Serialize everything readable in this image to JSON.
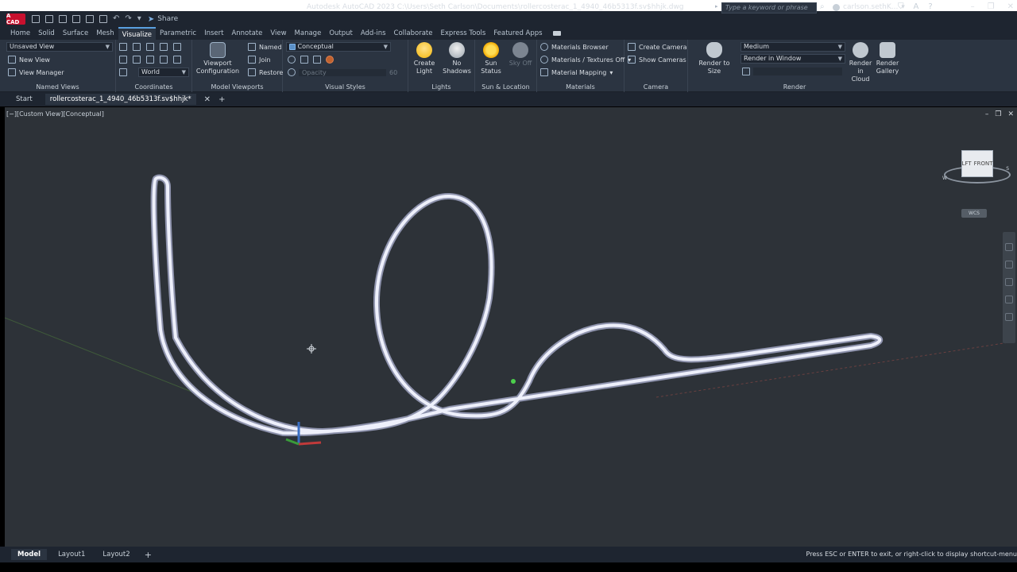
{
  "app": {
    "logo": "A CAD",
    "share_label": "Share",
    "title": "Autodesk AutoCAD 2023    C:\\Users\\Seth Carlson\\Documents\\rollercosterac_1_4940_46b5313f.sv$hhjk.dwg",
    "search_placeholder": "Type a keyword or phrase",
    "user": "carlson.sethK..."
  },
  "ribbon_tabs": [
    "Home",
    "Solid",
    "Surface",
    "Mesh",
    "Visualize",
    "Parametric",
    "Insert",
    "Annotate",
    "View",
    "Manage",
    "Output",
    "Add-ins",
    "Collaborate",
    "Express Tools",
    "Featured Apps"
  ],
  "active_tab": "Visualize",
  "panels": {
    "named_views": {
      "title": "Named Views",
      "dropdown": "Unsaved View",
      "new_view": "New View",
      "view_manager": "View Manager"
    },
    "coordinates": {
      "title": "Coordinates",
      "ucs_dropdown": "World"
    },
    "model_viewports": {
      "title": "Model Viewports",
      "config_label_1": "Viewport",
      "config_label_2": "Configuration",
      "named": "Named",
      "join": "Join",
      "restore": "Restore"
    },
    "visual_styles": {
      "title": "Visual Styles",
      "dropdown": "Conceptual",
      "opacity_label": "Opacity",
      "opacity_value": "60"
    },
    "lights": {
      "title": "Lights",
      "create_light_1": "Create",
      "create_light_2": "Light",
      "no_shadows_1": "No",
      "no_shadows_2": "Shadows"
    },
    "sun_location": {
      "title": "Sun & Location",
      "sun_status_1": "Sun",
      "sun_status_2": "Status",
      "sky_off": "Sky Off"
    },
    "materials": {
      "title": "Materials",
      "browser": "Materials Browser",
      "textures": "Materials / Textures Off",
      "mapping": "Material Mapping"
    },
    "camera": {
      "title": "Camera",
      "create": "Create Camera",
      "show": "Show  Cameras"
    },
    "render": {
      "title": "Render",
      "render_to_size": "Render to Size",
      "quality": "Medium",
      "render_in": "Render in Window",
      "cloud_1": "Render in",
      "cloud_2": "Cloud",
      "gallery_1": "Render",
      "gallery_2": "Gallery"
    }
  },
  "file_tabs": {
    "start": "Start",
    "document": "rollercosterac_1_4940_46b5313f.sv$hhjk*"
  },
  "viewport": {
    "label": "[−][Custom View][Conceptual]",
    "viewcube_face": "FRONT",
    "viewcube_side": "LFT",
    "compass_n": "W",
    "compass_s": "S",
    "wcs": "WCS"
  },
  "layout_tabs": [
    "Model",
    "Layout1",
    "Layout2"
  ],
  "active_layout": "Model",
  "status_message": "Press ESC or ENTER to exit, or right-click to display shortcut-menu"
}
